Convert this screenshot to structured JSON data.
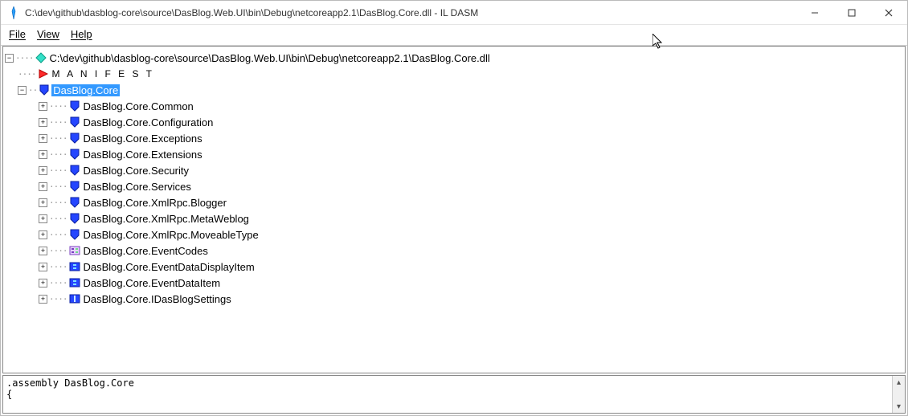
{
  "window": {
    "title": "C:\\dev\\github\\dasblog-core\\source\\DasBlog.Web.UI\\bin\\Debug\\netcoreapp2.1\\DasBlog.Core.dll - IL DASM"
  },
  "menu": {
    "file": "File",
    "view": "View",
    "help": "Help"
  },
  "tree": {
    "root": {
      "label": "C:\\dev\\github\\dasblog-core\\source\\DasBlog.Web.UI\\bin\\Debug\\netcoreapp2.1\\DasBlog.Core.dll"
    },
    "manifest": "M A N I F E S T",
    "assembly": {
      "label": "DasBlog.Core",
      "children": [
        {
          "label": "DasBlog.Core.Common",
          "icon": "shield"
        },
        {
          "label": "DasBlog.Core.Configuration",
          "icon": "shield"
        },
        {
          "label": "DasBlog.Core.Exceptions",
          "icon": "shield"
        },
        {
          "label": "DasBlog.Core.Extensions",
          "icon": "shield"
        },
        {
          "label": "DasBlog.Core.Security",
          "icon": "shield"
        },
        {
          "label": "DasBlog.Core.Services",
          "icon": "shield"
        },
        {
          "label": "DasBlog.Core.XmlRpc.Blogger",
          "icon": "shield"
        },
        {
          "label": "DasBlog.Core.XmlRpc.MetaWeblog",
          "icon": "shield"
        },
        {
          "label": "DasBlog.Core.XmlRpc.MoveableType",
          "icon": "shield"
        },
        {
          "label": "DasBlog.Core.EventCodes",
          "icon": "enum"
        },
        {
          "label": "DasBlog.Core.EventDataDisplayItem",
          "icon": "class"
        },
        {
          "label": "DasBlog.Core.EventDataItem",
          "icon": "class"
        },
        {
          "label": "DasBlog.Core.IDasBlogSettings",
          "icon": "interface"
        }
      ]
    }
  },
  "bottom": {
    "text": ".assembly DasBlog.Core\n{"
  }
}
